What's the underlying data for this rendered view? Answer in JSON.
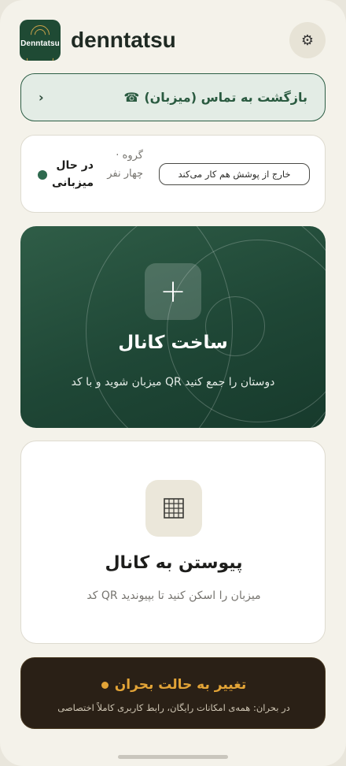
{
  "app": {
    "title": "denntatsu",
    "logo_text": "Denntatsu",
    "settings_icon": "⚙"
  },
  "return_call": {
    "label": "بازگشت به تماس (میزبان)",
    "phone_icon": "☎",
    "chevron": "›"
  },
  "status": {
    "coverage_label": "خارج از پوشش هم کار می‌کند",
    "group_info": "گروه · چهار نفر",
    "hosting_label": "در حال میزبانی",
    "dot_color": "#2f6a4f"
  },
  "create_channel": {
    "icon": "+",
    "title": "ساخت کانال",
    "subtitle": "دوستان را جمع کنید QR میزبان شوید و با کد"
  },
  "join_channel": {
    "icon": "qr-grid-icon",
    "title": "پیوستن به کانال",
    "subtitle": "میزبان را اسکن کنید تا بپیوندید QR کد"
  },
  "crisis": {
    "title": "تغییر به حالت بحران",
    "subtitle": "در بحران: همه‌ی امکانات رایگان، رابط کاربری کاملاً اختصاصی",
    "accent": "#e3a437"
  },
  "colors": {
    "brand_green": "#1f4a34",
    "background": "#f4f2ea"
  }
}
